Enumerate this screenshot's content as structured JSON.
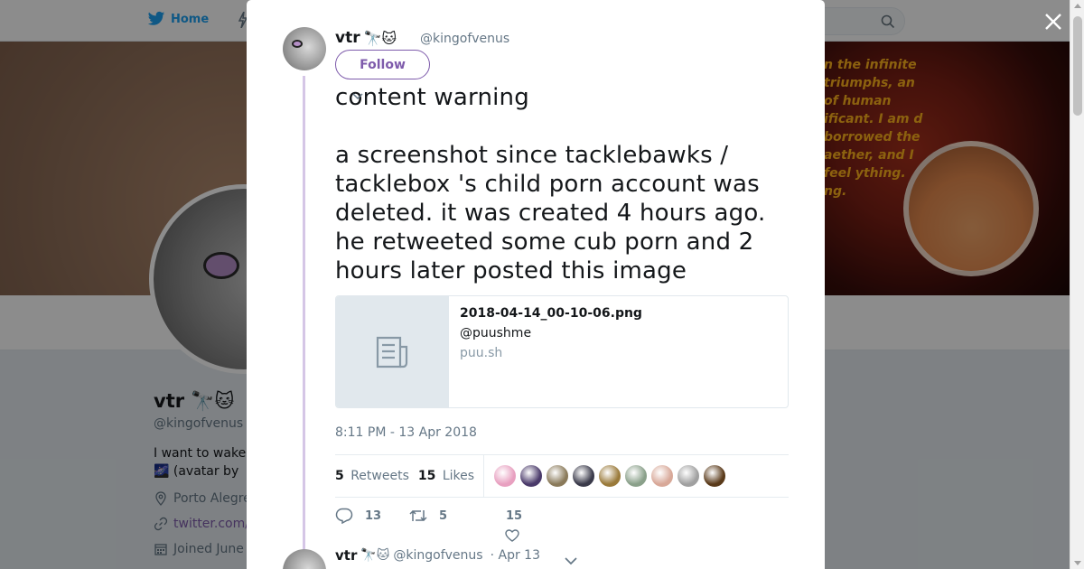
{
  "nav": {
    "home_label": "Home",
    "search_icon": "search-icon",
    "brand_color": "#1da1f2"
  },
  "banner": {
    "space_text": "n the infinite triumphs, an of human ificant. I am d borrowed the aether, and I feel ything. ng."
  },
  "profile": {
    "name": "vtr 🔭🐱",
    "handle": "@kingofvenus",
    "bio_line1": "I want to wake",
    "bio_line2": "🌌 (avatar by",
    "location": "Porto Alegre",
    "link": "twitter.com/",
    "joined": "Joined June"
  },
  "tweet": {
    "author_name": "vtr",
    "author_emoji": "🔭🐱",
    "author_handle": "@kingofvenus",
    "follow_label": "Follow",
    "content_warning": "content warning",
    "body": "a screenshot since tacklebawks / tacklebox 's child porn account was deleted. it was created 4 hours ago. he retweeted some cub porn and 2 hours later posted this image",
    "card": {
      "title": "2018-04-14_00-10-06.png",
      "description": "@puushme",
      "domain": "puu.sh"
    },
    "timestamp": "8:11 PM - 13 Apr 2018",
    "retweets_count": "5",
    "retweets_label": "Retweets",
    "likes_count": "15",
    "likes_label": "Likes",
    "likers": [
      {
        "name": "liker-1",
        "color": "#e8a0c0"
      },
      {
        "name": "liker-2",
        "color": "#4a3a6a"
      },
      {
        "name": "liker-3",
        "color": "#8a7a5a"
      },
      {
        "name": "liker-4",
        "color": "#3a3a4a"
      },
      {
        "name": "liker-5",
        "color": "#9a7a3a"
      },
      {
        "name": "liker-6",
        "color": "#8aa08a"
      },
      {
        "name": "liker-7",
        "color": "#d8a898"
      },
      {
        "name": "liker-8",
        "color": "#a0a0a0"
      },
      {
        "name": "liker-9",
        "color": "#5a3a1a"
      }
    ],
    "actions": {
      "replies": "13",
      "retweets": "5",
      "likes": "15"
    },
    "accent_color": "#7e5bab"
  },
  "reply": {
    "author_name": "vtr",
    "author_emoji": "🔭🐱",
    "author_handle": "@kingofvenus",
    "date": "· Apr 13"
  }
}
